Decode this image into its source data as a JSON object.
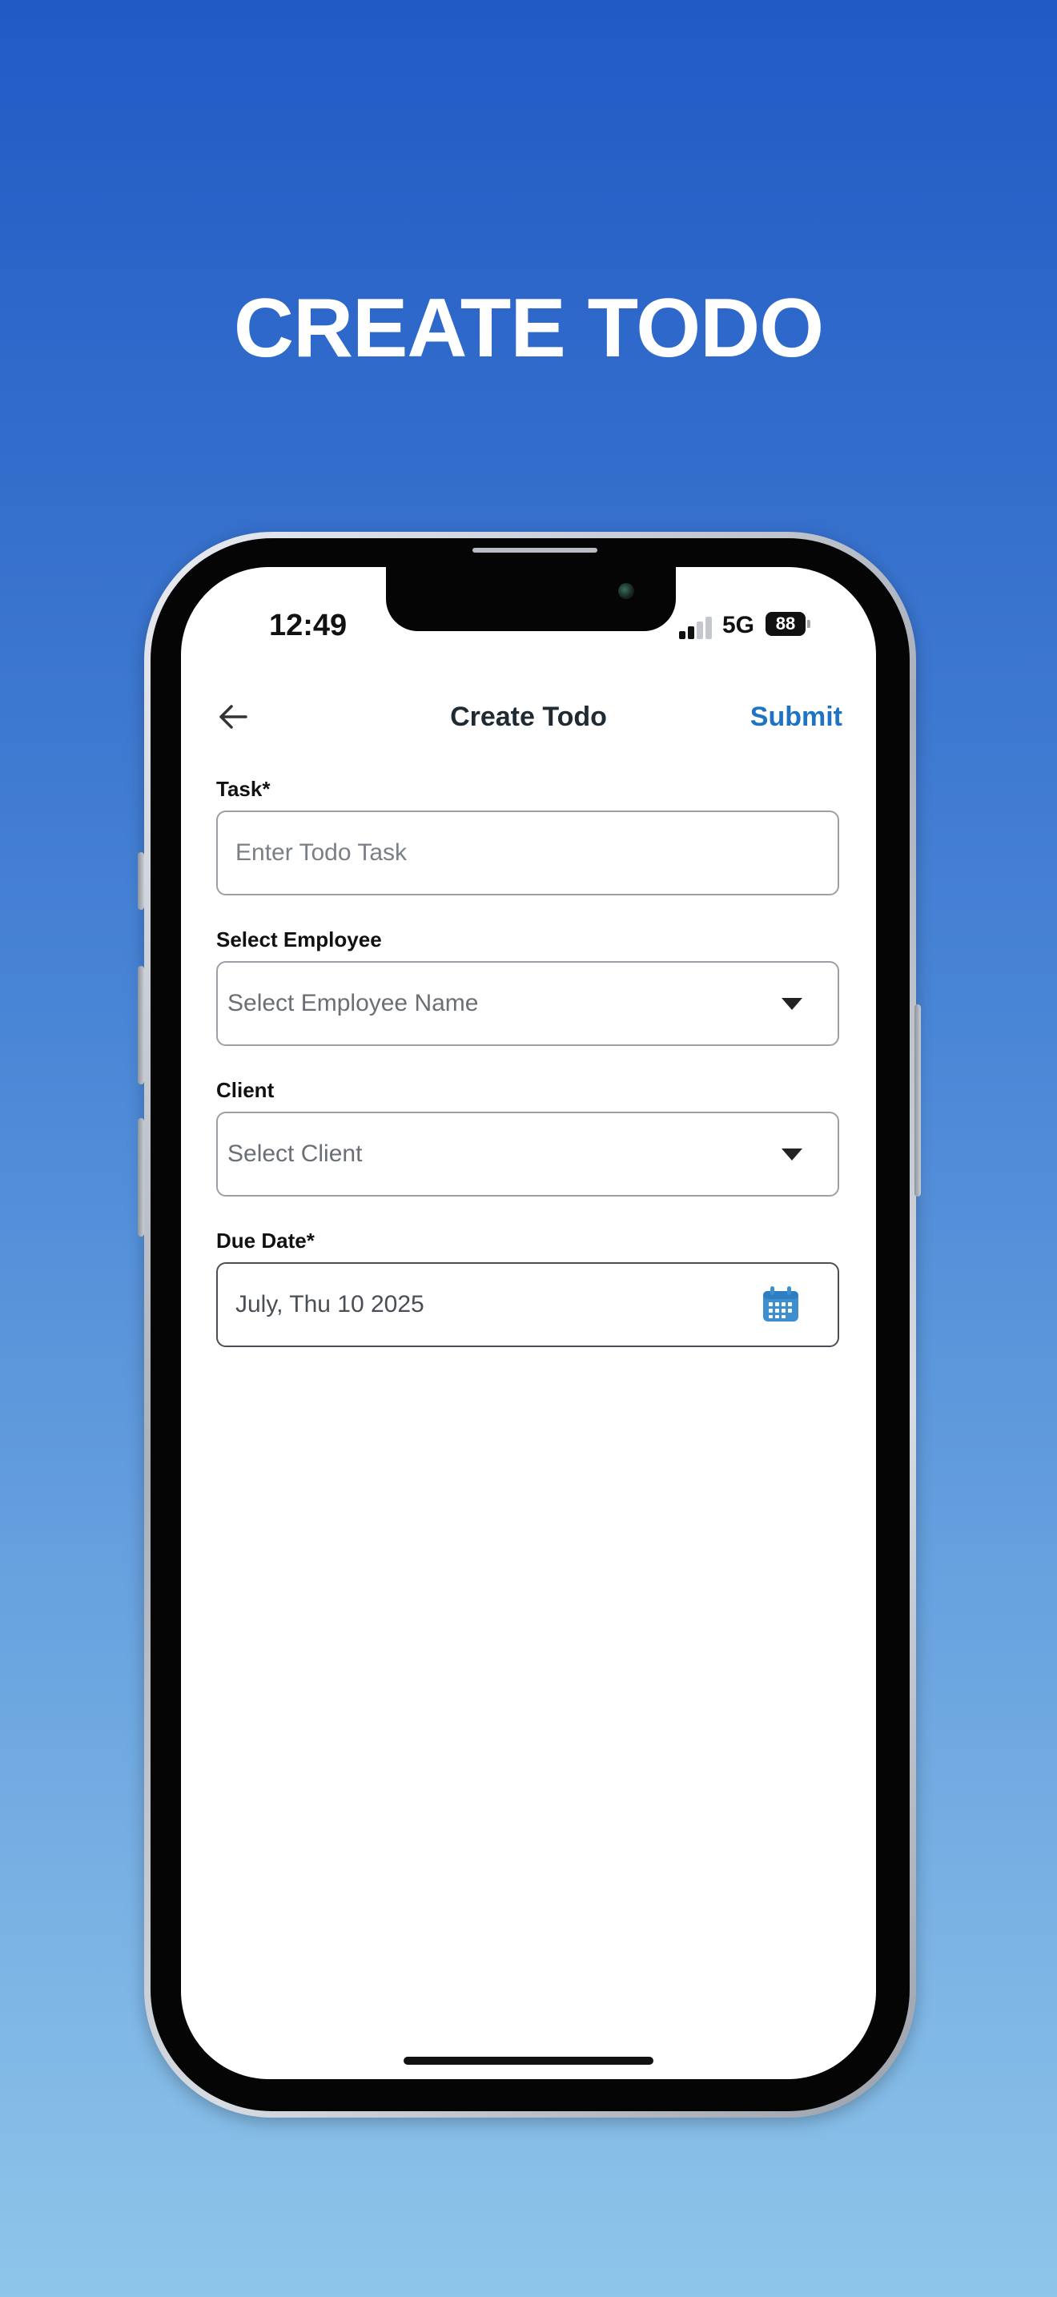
{
  "headline": "CREATE TODO",
  "status_bar": {
    "time": "12:49",
    "network": "5G",
    "battery": "88"
  },
  "header": {
    "title": "Create Todo",
    "back_icon": "arrow-left-icon",
    "submit_label": "Submit"
  },
  "form": {
    "task": {
      "label": "Task*",
      "placeholder": "Enter Todo Task",
      "value": ""
    },
    "employee": {
      "label": "Select Employee",
      "placeholder": "Select Employee Name",
      "icon": "caret-down-icon"
    },
    "client": {
      "label": "Client",
      "placeholder": "Select Client",
      "icon": "caret-down-icon"
    },
    "due_date": {
      "label": "Due Date*",
      "value": "July, Thu 10 2025",
      "icon": "calendar-icon"
    }
  },
  "colors": {
    "accent": "#1f73c2",
    "calendar_icon": "#3d8fd0",
    "background_top": "#215AC4",
    "background_bottom": "#8EC5EA"
  }
}
